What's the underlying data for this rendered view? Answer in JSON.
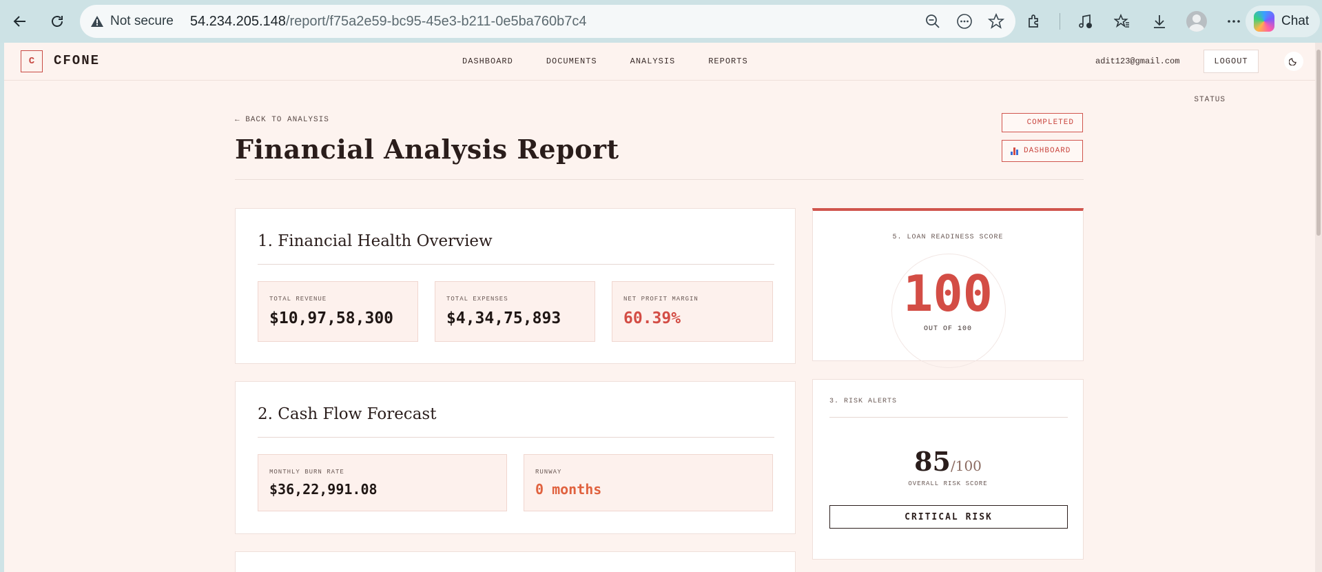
{
  "browser": {
    "security_label": "Not secure",
    "url_host": "54.234.205.148",
    "url_path": "/report/f75a2e59-bc95-45e3-b211-0e5ba760b7c4",
    "chat_label": "Chat"
  },
  "header": {
    "logo_letter": "C",
    "brand": "CFONE",
    "nav": [
      "DASHBOARD",
      "DOCUMENTS",
      "ANALYSIS",
      "REPORTS"
    ],
    "user_email": "adit123@gmail.com",
    "logout_label": "LOGOUT"
  },
  "report": {
    "back_link": "← BACK TO ANALYSIS",
    "title": "Financial Analysis Report",
    "status_label": "STATUS",
    "status_value": "COMPLETED",
    "dashboard_button": "DASHBOARD"
  },
  "financial_health": {
    "title": "1. Financial Health Overview",
    "metrics": [
      {
        "label": "TOTAL REVENUE",
        "value": "$10,97,58,300"
      },
      {
        "label": "TOTAL EXPENSES",
        "value": "$4,34,75,893"
      },
      {
        "label": "NET PROFIT MARGIN",
        "value": "60.39%"
      }
    ]
  },
  "cash_flow": {
    "title": "2. Cash Flow Forecast",
    "metrics": [
      {
        "label": "MONTHLY BURN RATE",
        "value": "$36,22,991.08"
      },
      {
        "label": "RUNWAY",
        "value": "0 months"
      }
    ]
  },
  "loan_readiness": {
    "label": "5. LOAN READINESS SCORE",
    "score": "100",
    "out_of": "OUT OF 100"
  },
  "risk_alerts": {
    "label": "3. RISK ALERTS",
    "score": "85",
    "score_suffix": "/100",
    "caption": "OVERALL RISK SCORE",
    "level": "CRITICAL RISK"
  },
  "colors": {
    "accent": "#d34d45",
    "page_bg": "#fdf3ef",
    "runway": "#e0623f"
  }
}
